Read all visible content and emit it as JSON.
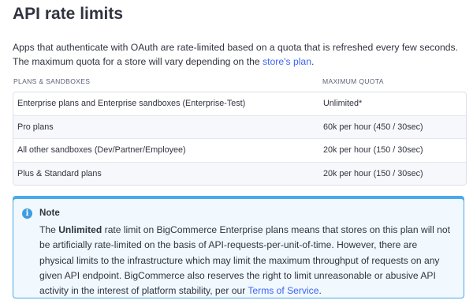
{
  "page": {
    "title": "API rate limits",
    "intro_text": "Apps that authenticate with OAuth are rate-limited based on a quota that is refreshed every few seconds. The maximum quota for a store will vary depending on the ",
    "intro_link": "store's plan",
    "intro_end": "."
  },
  "table": {
    "headers": {
      "plans": "PLANS & SANDBOXES",
      "quota": "MAXIMUM QUOTA"
    },
    "rows": [
      {
        "plan": "Enterprise plans and Enterprise sandboxes (Enterprise-Test)",
        "quota": "Unlimited*"
      },
      {
        "plan": "Pro plans",
        "quota": "60k per hour (450 / 30sec)"
      },
      {
        "plan": "All other sandboxes (Dev/Partner/Employee)",
        "quota": "20k per hour (150 / 30sec)"
      },
      {
        "plan": "Plus & Standard plans",
        "quota": "20k per hour (150 / 30sec)"
      }
    ]
  },
  "note": {
    "icon": "info-icon",
    "icon_glyph": "i",
    "title": "Note",
    "body_start": "The ",
    "body_bold": "Unlimited",
    "body_rest": " rate limit on BigCommerce Enterprise plans means that stores on this plan will not be artificially rate-limited on the basis of API-requests-per-unit-of-time. However, there are physical limits to the infrastructure which may limit the maximum throughput of requests on any given API endpoint. BigCommerce also reserves the right to limit unreasonable or abusive API activity in the interest of platform stability, per our ",
    "body_link": "Terms of Service",
    "body_end": "."
  },
  "colors": {
    "link": "#3c64f4",
    "note_border": "#4aa9e8",
    "note_background": "#f1f8fe",
    "text": "#313440"
  }
}
